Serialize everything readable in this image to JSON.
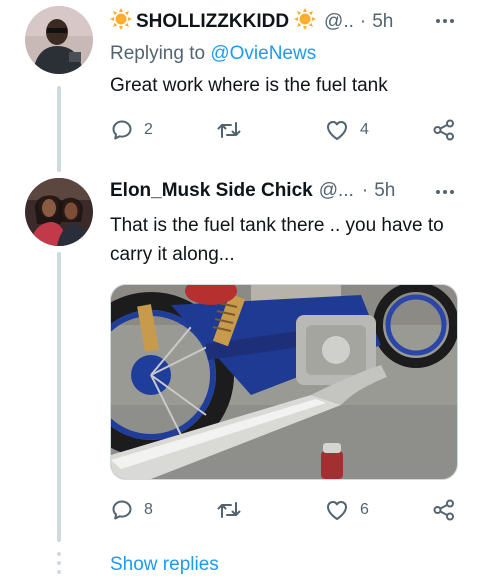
{
  "tweet1": {
    "name": "SHOLLIZZKKIDD",
    "name_emoji_left": "sun",
    "name_emoji_right": "sun",
    "handle": "@..",
    "separator": "·",
    "time": "5h",
    "replying_prefix": "Replying to",
    "replying_handle": "@OvieNews",
    "text": "Great work where is the fuel tank",
    "replies": "2",
    "retweets": "",
    "likes": "4"
  },
  "tweet2": {
    "name": "Elon_Musk Side Chick",
    "handle": "@...",
    "separator": "·",
    "time": "5h",
    "text": "That is the fuel tank there .. you have to carry it along...",
    "replies": "8",
    "retweets": "",
    "likes": "6",
    "media_description_icon": "photo"
  },
  "show_replies": "Show replies",
  "colors": {
    "accent": "#1d9bf0",
    "muted": "#536471",
    "thread_line": "#cfd9de"
  }
}
